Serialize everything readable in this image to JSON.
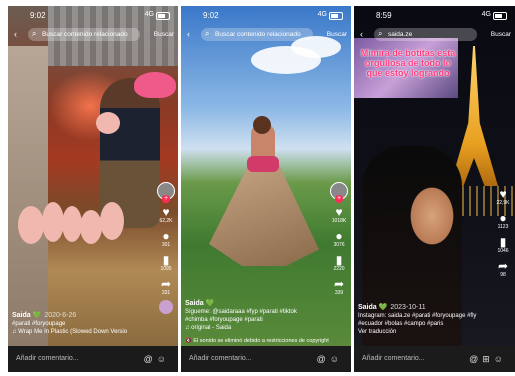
{
  "panels": [
    {
      "time": "9:02",
      "network": "4G",
      "search_placeholder": "Buscar contenido relacionado",
      "search_button": "Buscar",
      "likes": "62,2K",
      "comments": "301",
      "saves": "1095",
      "shares": "331",
      "username": "Saida",
      "date": "2020-6-26",
      "caption": "#parati #foryoupage",
      "music": "Wrap Me In Plastic (Slowed Down Versio",
      "comment_placeholder": "Añadir comentario..."
    },
    {
      "time": "9:02",
      "network": "4G",
      "search_placeholder": "Buscar contenido relacionado",
      "search_button": "Buscar",
      "likes": "1018K",
      "comments": "3076",
      "saves": "2220",
      "shares": "339",
      "username": "Saida",
      "caption": "Sígueme: @saidaraaa #fyp #parati #tiktok #chimba #foryoupage #parati",
      "music": "original - Saida",
      "notice": "El sonido se eliminó debido a restricciones de copyright",
      "comment_placeholder": "Añadir comentario..."
    },
    {
      "time": "8:59",
      "network": "4G",
      "search_value": "saida.ze",
      "search_button": "Buscar",
      "overlay": "Mimira de botitas esta orgullosa de todo lo que estoy logrando",
      "likes": "22,9K",
      "comments": "1123",
      "saves": "1046",
      "shares": "98",
      "username": "Saida",
      "date": "2023-10-11",
      "caption": "Instagram: saida.ze #parati #foryoupage #fly #ecuador #bolas #campo #paris",
      "translate": "Ver traducción",
      "comment_placeholder": "Añadir comentario..."
    }
  ],
  "icons": {
    "back": "chevron-left-icon",
    "search": "magnifier-icon",
    "like": "heart-icon",
    "comment": "speech-bubble-icon",
    "save": "bookmark-icon",
    "share": "share-arrow-icon",
    "mention": "at-icon",
    "emoji": "smiley-icon",
    "gift": "gift-icon"
  },
  "colors": {
    "accent": "#fe2c55",
    "comment_bar": "#1b1b1b"
  }
}
